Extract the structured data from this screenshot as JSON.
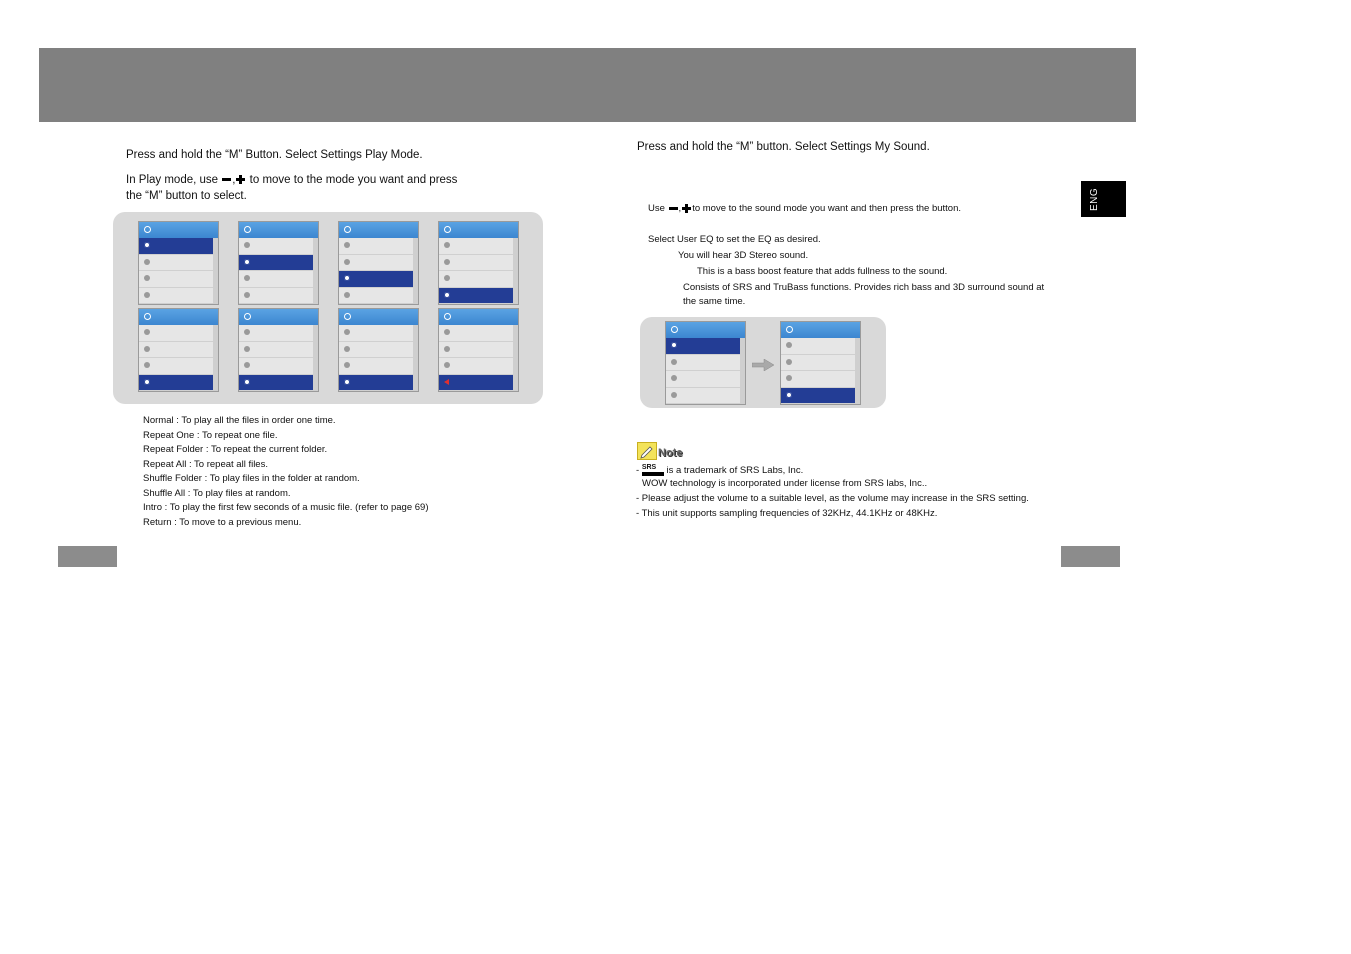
{
  "left": {
    "instruction1": "Press and hold the “M” Button. Select Settings     Play Mode.",
    "instruction2_before": "In Play mode, use",
    "instruction2_after": "to move to the mode you want and press",
    "instruction2_line2": "the “M” button to select.",
    "screens_selected_rows": [
      0,
      1,
      2,
      3,
      3,
      3,
      3,
      3
    ],
    "modes": [
      "Normal : To play all the files in order one time.",
      "Repeat One  : To repeat one file.",
      "Repeat Folder : To repeat the current folder.",
      "Repeat All : To repeat all files.",
      "Shuffle Folder : To play files in the folder at random.",
      "Shuffle All : To play files at random.",
      "Intro : To play the first few seconds of a music file. (refer to page 69)",
      "Return : To move to a previous menu."
    ]
  },
  "right": {
    "instruction1": "Press and hold the “M” button. Select Settings     My Sound.",
    "use_before": "Use",
    "use_after": "to move to the sound mode you want and then press the         button.",
    "user_eq": "Select User EQ to set the EQ as desired.",
    "stereo": "You will hear 3D Stereo sound.",
    "bass": "This is a bass boost feature that adds fullness to the sound.",
    "srs_line1": "Consists of SRS and TruBass functions. Provides rich bass and 3D surround sound at",
    "srs_line2": "the same time.",
    "eng_tab": "ENG",
    "note_label": "Note",
    "note_srs_text": "is a trademark of SRS Labs, Inc.",
    "note_wow": "WOW technology is incorporated under license from SRS labs, Inc..",
    "note_volume": "- Please adjust the volume to a suitable level, as the volume may increase in the SRS setting.",
    "note_sampling": "- This unit supports sampling frequencies of 32KHz, 44.1KHz or 48KHz.",
    "note_dash": "-",
    "srs_logo_text": "SRS"
  },
  "colors": {
    "header": "#808080",
    "selection": "#233d95",
    "screen_header": "#4a95dc",
    "panel": "#d9d9d9"
  }
}
